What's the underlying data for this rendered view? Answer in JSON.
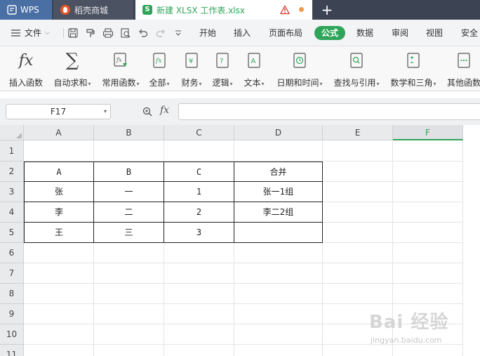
{
  "tabs": {
    "wps": "WPS",
    "daoke": "稻壳商城",
    "file": "新建 XLSX 工作表.xlsx",
    "new_tab": "+"
  },
  "menu": {
    "file": "文件",
    "items": [
      "开始",
      "插入",
      "页面布局",
      "公式",
      "数据",
      "审阅",
      "视图",
      "安全"
    ],
    "active": "公式"
  },
  "ribbon": {
    "buttons": [
      {
        "label": "插入函数",
        "icon": "fx-icon",
        "dropdown": false
      },
      {
        "label": "自动求和",
        "icon": "sigma-icon",
        "dropdown": true
      },
      {
        "label": "常用函数",
        "icon": "common-function-icon",
        "dropdown": true
      },
      {
        "label": "全部",
        "icon": "all-functions-icon",
        "dropdown": true
      },
      {
        "label": "财务",
        "icon": "finance-icon",
        "dropdown": true
      },
      {
        "label": "逻辑",
        "icon": "logic-icon",
        "dropdown": true
      },
      {
        "label": "文本",
        "icon": "text-icon",
        "dropdown": true
      },
      {
        "label": "日期和时间",
        "icon": "date-time-icon",
        "dropdown": true
      },
      {
        "label": "查找与引用",
        "icon": "lookup-icon",
        "dropdown": true
      },
      {
        "label": "数学和三角",
        "icon": "math-icon",
        "dropdown": true
      },
      {
        "label": "其他函数",
        "icon": "other-functions-icon",
        "dropdown": false
      }
    ]
  },
  "formula_bar": {
    "name_box": "F17",
    "fx": "fx",
    "formula": ""
  },
  "sheet": {
    "columns": [
      "A",
      "B",
      "C",
      "D",
      "E",
      "F"
    ],
    "active_column": "F",
    "rows": [
      "1",
      "2",
      "3",
      "4",
      "5",
      "6",
      "7",
      "8",
      "9",
      "10",
      "11"
    ],
    "cells": {
      "A2": "A",
      "B2": "B",
      "C2": "C",
      "D2": "合并",
      "A3": "张",
      "B3": "一",
      "C3": "1",
      "D3": "张一1组",
      "A4": "李",
      "B4": "二",
      "C4": "2",
      "D4": "李二2组",
      "A5": "王",
      "B5": "三",
      "C5": "3",
      "D5": ""
    }
  },
  "watermark": {
    "text": "Bai 经验",
    "url": "jingyan.baidu.com"
  },
  "colors": {
    "accent": "#2fa55a",
    "titlebar": "#3c4453"
  }
}
